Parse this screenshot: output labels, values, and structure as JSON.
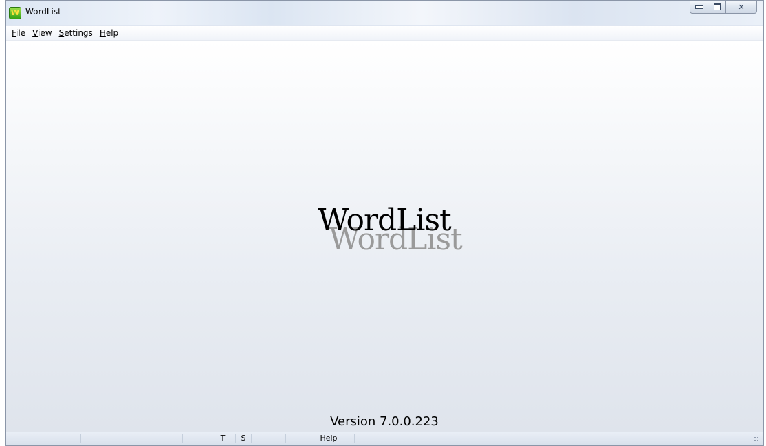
{
  "window": {
    "title": "WordList",
    "buttons": {
      "minimize": "minimize",
      "maximize": "maximize",
      "close": "close"
    }
  },
  "menu": [
    {
      "id": "file",
      "hotkey": "F",
      "rest": "ile"
    },
    {
      "id": "view",
      "hotkey": "V",
      "rest": "iew"
    },
    {
      "id": "settings",
      "hotkey": "S",
      "rest": "ettings"
    },
    {
      "id": "help",
      "hotkey": "H",
      "rest": "elp"
    }
  ],
  "splash": {
    "logo": "WordList",
    "version": "Version 7.0.0.223"
  },
  "statusbar": {
    "t": "T",
    "s": "S",
    "help": "Help"
  },
  "icons": {
    "app": "wordlist-app-icon",
    "close": "✕"
  }
}
